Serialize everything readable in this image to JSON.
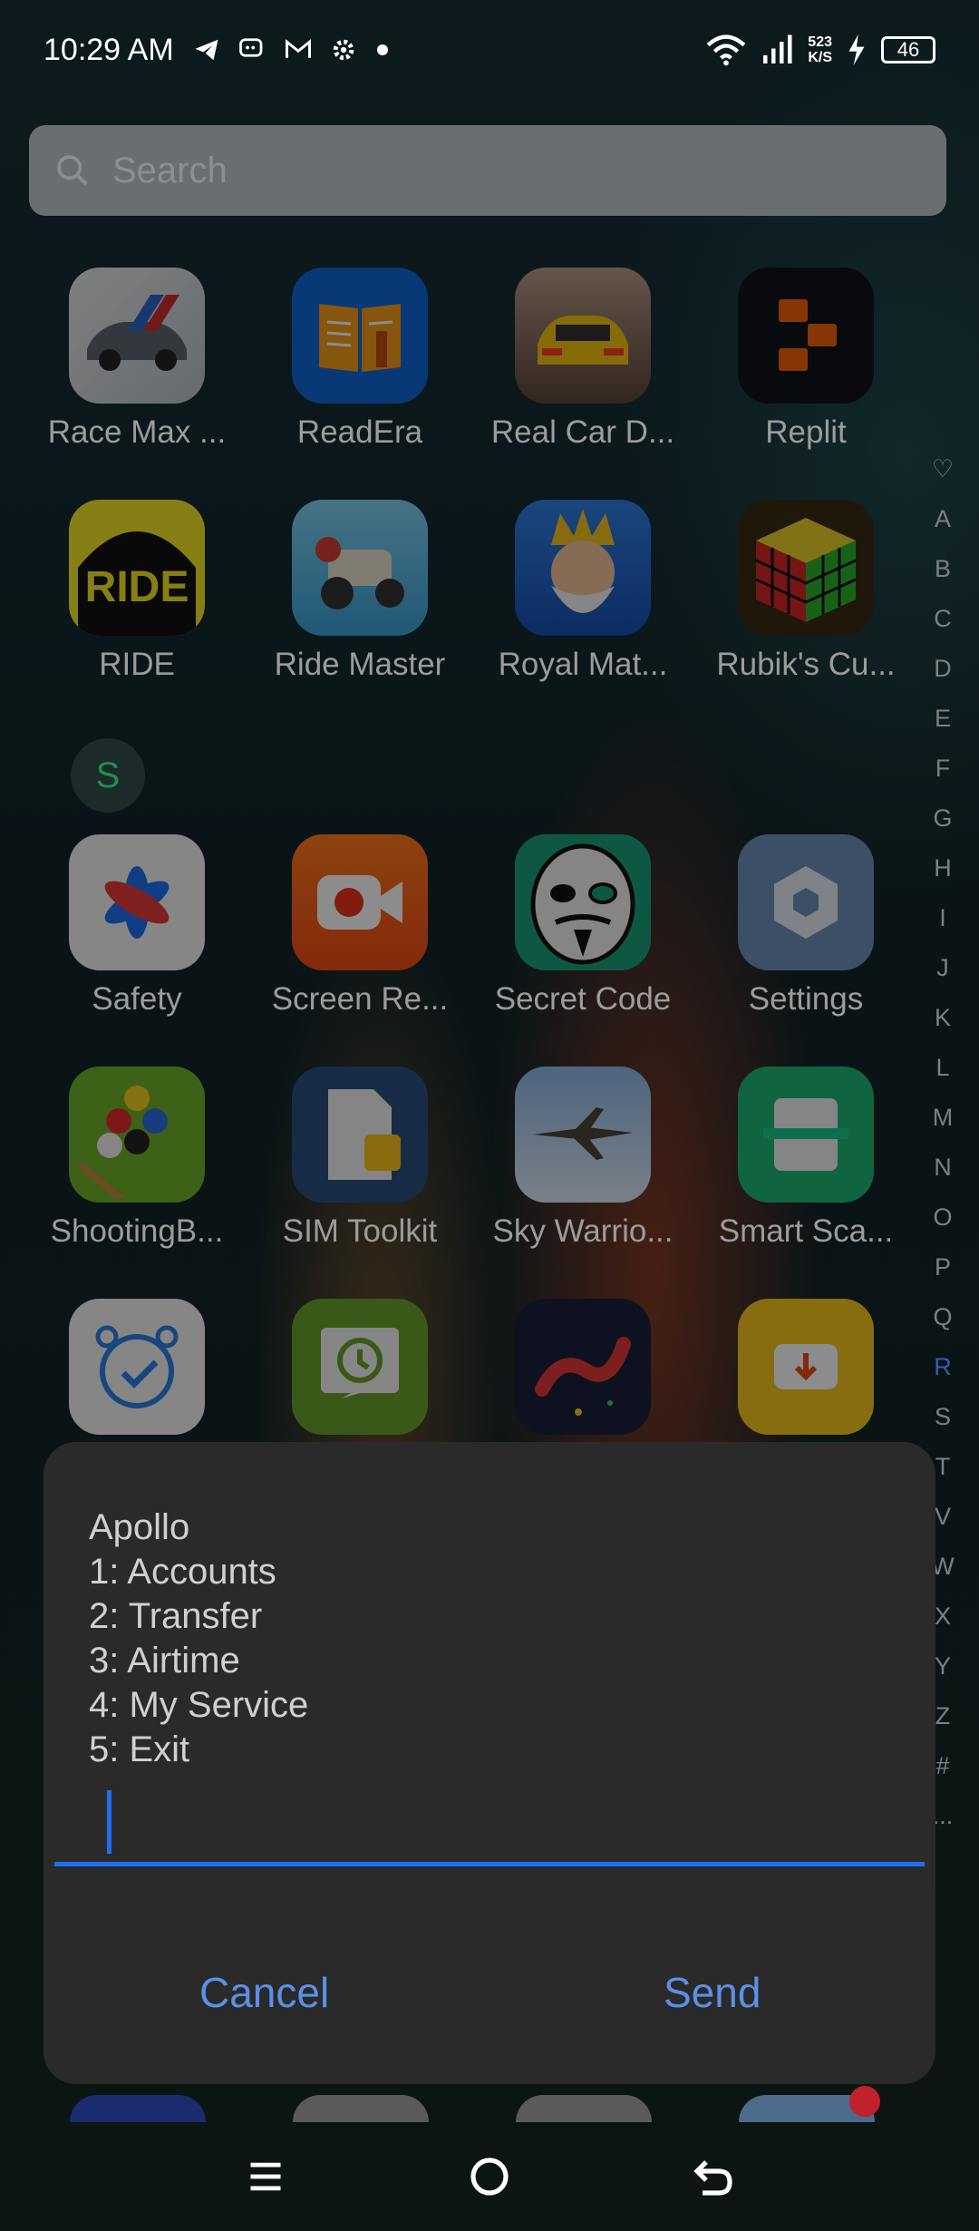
{
  "status_bar": {
    "time": "10:29 AM",
    "notification_icons": [
      "telegram-icon",
      "chat-icon",
      "gmail-icon",
      "settings-icon",
      "dot-icon"
    ],
    "net_speed_value": "523",
    "net_speed_unit": "K/S",
    "battery": "46"
  },
  "search": {
    "placeholder": "Search"
  },
  "apps": [
    {
      "label": "Race Max ...",
      "icon": "race-max-icon"
    },
    {
      "label": "ReadEra",
      "icon": "readera-icon"
    },
    {
      "label": "Real Car D...",
      "icon": "real-car-icon"
    },
    {
      "label": "Replit",
      "icon": "replit-icon"
    },
    {
      "label": "RIDE",
      "icon": "ride-icon"
    },
    {
      "label": "Ride Master",
      "icon": "ride-master-icon"
    },
    {
      "label": "Royal Mat...",
      "icon": "royal-match-icon"
    },
    {
      "label": "Rubik's Cu...",
      "icon": "rubiks-cube-icon"
    },
    {
      "label": "Safety",
      "icon": "safety-icon"
    },
    {
      "label": "Screen Re...",
      "icon": "screen-recorder-icon"
    },
    {
      "label": "Secret Code",
      "icon": "secret-code-icon"
    },
    {
      "label": "Settings",
      "icon": "settings-app-icon"
    },
    {
      "label": "ShootingB...",
      "icon": "shooting-ball-icon"
    },
    {
      "label": "SIM Toolkit",
      "icon": "sim-toolkit-icon"
    },
    {
      "label": "Sky Warrio...",
      "icon": "sky-warrior-icon"
    },
    {
      "label": "Smart Sca...",
      "icon": "smart-scan-icon"
    }
  ],
  "section_letter": "S",
  "alphabet": [
    "♡",
    "A",
    "B",
    "C",
    "D",
    "E",
    "F",
    "G",
    "H",
    "I",
    "J",
    "K",
    "L",
    "M",
    "N",
    "O",
    "P",
    "Q",
    "R",
    "S",
    "T",
    "V",
    "W",
    "X",
    "Y",
    "Z",
    "#",
    "..."
  ],
  "alphabet_active": "R",
  "ussd_dialog": {
    "lines": [
      "Apollo",
      "1: Accounts",
      "2: Transfer",
      "3: Airtime",
      "4: My Service",
      "5: Exit"
    ],
    "input_value": "",
    "cancel_label": "Cancel",
    "send_label": "Send"
  },
  "navbar": {
    "icons": [
      "menu-icon",
      "home-icon",
      "back-icon"
    ]
  },
  "colors": {
    "accent": "#1e6ff0",
    "button_text": "#5c8fe8",
    "dialog_bg": "#2a2a2a"
  }
}
